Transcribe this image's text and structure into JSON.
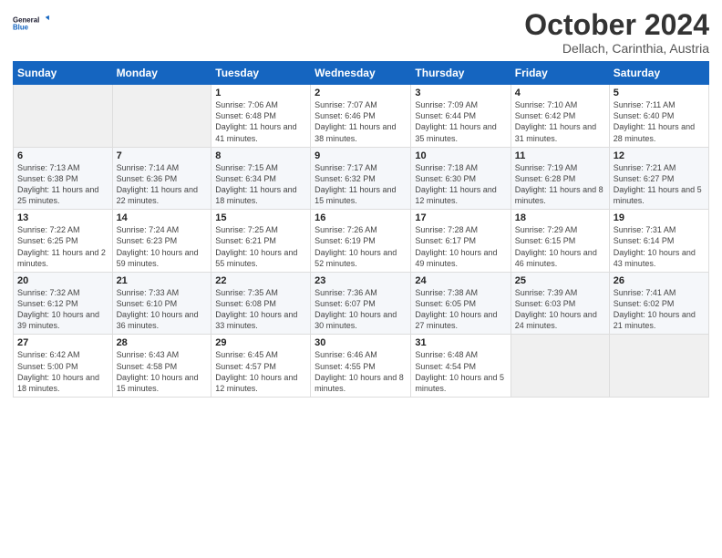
{
  "logo": {
    "line1": "General",
    "line2": "Blue"
  },
  "title": "October 2024",
  "location": "Dellach, Carinthia, Austria",
  "days_of_week": [
    "Sunday",
    "Monday",
    "Tuesday",
    "Wednesday",
    "Thursday",
    "Friday",
    "Saturday"
  ],
  "weeks": [
    [
      {
        "day": "",
        "info": ""
      },
      {
        "day": "",
        "info": ""
      },
      {
        "day": "1",
        "info": "Sunrise: 7:06 AM\nSunset: 6:48 PM\nDaylight: 11 hours and 41 minutes."
      },
      {
        "day": "2",
        "info": "Sunrise: 7:07 AM\nSunset: 6:46 PM\nDaylight: 11 hours and 38 minutes."
      },
      {
        "day": "3",
        "info": "Sunrise: 7:09 AM\nSunset: 6:44 PM\nDaylight: 11 hours and 35 minutes."
      },
      {
        "day": "4",
        "info": "Sunrise: 7:10 AM\nSunset: 6:42 PM\nDaylight: 11 hours and 31 minutes."
      },
      {
        "day": "5",
        "info": "Sunrise: 7:11 AM\nSunset: 6:40 PM\nDaylight: 11 hours and 28 minutes."
      }
    ],
    [
      {
        "day": "6",
        "info": "Sunrise: 7:13 AM\nSunset: 6:38 PM\nDaylight: 11 hours and 25 minutes."
      },
      {
        "day": "7",
        "info": "Sunrise: 7:14 AM\nSunset: 6:36 PM\nDaylight: 11 hours and 22 minutes."
      },
      {
        "day": "8",
        "info": "Sunrise: 7:15 AM\nSunset: 6:34 PM\nDaylight: 11 hours and 18 minutes."
      },
      {
        "day": "9",
        "info": "Sunrise: 7:17 AM\nSunset: 6:32 PM\nDaylight: 11 hours and 15 minutes."
      },
      {
        "day": "10",
        "info": "Sunrise: 7:18 AM\nSunset: 6:30 PM\nDaylight: 11 hours and 12 minutes."
      },
      {
        "day": "11",
        "info": "Sunrise: 7:19 AM\nSunset: 6:28 PM\nDaylight: 11 hours and 8 minutes."
      },
      {
        "day": "12",
        "info": "Sunrise: 7:21 AM\nSunset: 6:27 PM\nDaylight: 11 hours and 5 minutes."
      }
    ],
    [
      {
        "day": "13",
        "info": "Sunrise: 7:22 AM\nSunset: 6:25 PM\nDaylight: 11 hours and 2 minutes."
      },
      {
        "day": "14",
        "info": "Sunrise: 7:24 AM\nSunset: 6:23 PM\nDaylight: 10 hours and 59 minutes."
      },
      {
        "day": "15",
        "info": "Sunrise: 7:25 AM\nSunset: 6:21 PM\nDaylight: 10 hours and 55 minutes."
      },
      {
        "day": "16",
        "info": "Sunrise: 7:26 AM\nSunset: 6:19 PM\nDaylight: 10 hours and 52 minutes."
      },
      {
        "day": "17",
        "info": "Sunrise: 7:28 AM\nSunset: 6:17 PM\nDaylight: 10 hours and 49 minutes."
      },
      {
        "day": "18",
        "info": "Sunrise: 7:29 AM\nSunset: 6:15 PM\nDaylight: 10 hours and 46 minutes."
      },
      {
        "day": "19",
        "info": "Sunrise: 7:31 AM\nSunset: 6:14 PM\nDaylight: 10 hours and 43 minutes."
      }
    ],
    [
      {
        "day": "20",
        "info": "Sunrise: 7:32 AM\nSunset: 6:12 PM\nDaylight: 10 hours and 39 minutes."
      },
      {
        "day": "21",
        "info": "Sunrise: 7:33 AM\nSunset: 6:10 PM\nDaylight: 10 hours and 36 minutes."
      },
      {
        "day": "22",
        "info": "Sunrise: 7:35 AM\nSunset: 6:08 PM\nDaylight: 10 hours and 33 minutes."
      },
      {
        "day": "23",
        "info": "Sunrise: 7:36 AM\nSunset: 6:07 PM\nDaylight: 10 hours and 30 minutes."
      },
      {
        "day": "24",
        "info": "Sunrise: 7:38 AM\nSunset: 6:05 PM\nDaylight: 10 hours and 27 minutes."
      },
      {
        "day": "25",
        "info": "Sunrise: 7:39 AM\nSunset: 6:03 PM\nDaylight: 10 hours and 24 minutes."
      },
      {
        "day": "26",
        "info": "Sunrise: 7:41 AM\nSunset: 6:02 PM\nDaylight: 10 hours and 21 minutes."
      }
    ],
    [
      {
        "day": "27",
        "info": "Sunrise: 6:42 AM\nSunset: 5:00 PM\nDaylight: 10 hours and 18 minutes."
      },
      {
        "day": "28",
        "info": "Sunrise: 6:43 AM\nSunset: 4:58 PM\nDaylight: 10 hours and 15 minutes."
      },
      {
        "day": "29",
        "info": "Sunrise: 6:45 AM\nSunset: 4:57 PM\nDaylight: 10 hours and 12 minutes."
      },
      {
        "day": "30",
        "info": "Sunrise: 6:46 AM\nSunset: 4:55 PM\nDaylight: 10 hours and 8 minutes."
      },
      {
        "day": "31",
        "info": "Sunrise: 6:48 AM\nSunset: 4:54 PM\nDaylight: 10 hours and 5 minutes."
      },
      {
        "day": "",
        "info": ""
      },
      {
        "day": "",
        "info": ""
      }
    ]
  ]
}
